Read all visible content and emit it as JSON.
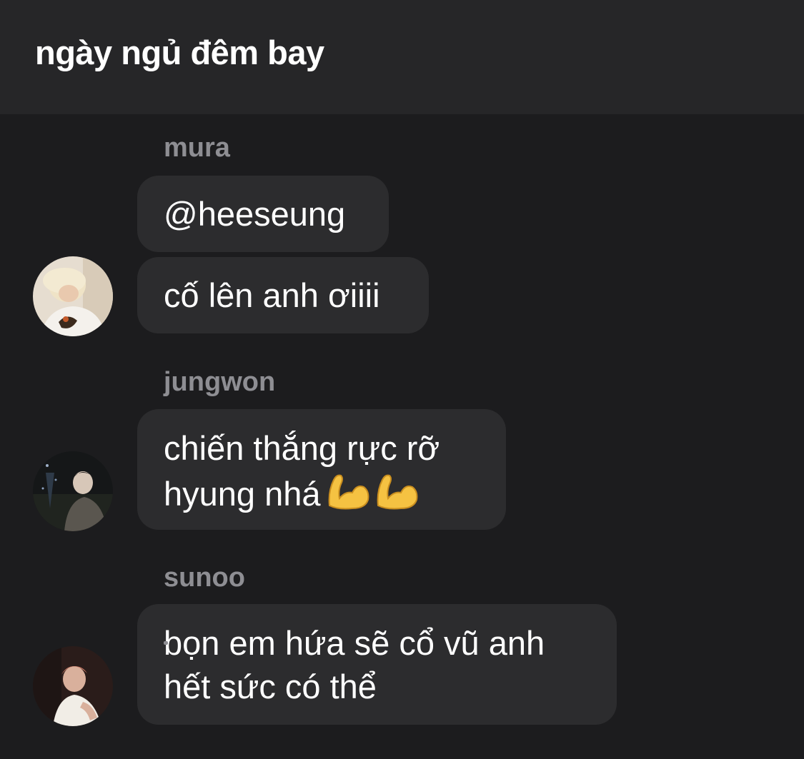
{
  "header": {
    "title": "ngày ngủ đêm bay"
  },
  "messages": [
    {
      "sender": "mura",
      "avatar_icon": "avatar-mura",
      "bubbles": [
        "@heeseung",
        "cố lên anh ơiiii"
      ]
    },
    {
      "sender": "jungwon",
      "avatar_icon": "avatar-jungwon",
      "bubbles": [
        [
          "chiến thắng rực rỡ",
          "hyung nhá"
        ]
      ],
      "emoji": "flexed-biceps-icon"
    },
    {
      "sender": "sunoo",
      "avatar_icon": "avatar-sunoo",
      "bubbles": [
        [
          "bọn em hứa sẽ cổ vũ anh",
          "hết sức có thể"
        ]
      ]
    }
  ],
  "colors": {
    "background": "#1c1c1e",
    "header_background": "#262628",
    "bubble_background": "#2c2c2e",
    "sender_name": "#8e8e93",
    "text": "#ffffff",
    "emoji": "#f5c242"
  }
}
